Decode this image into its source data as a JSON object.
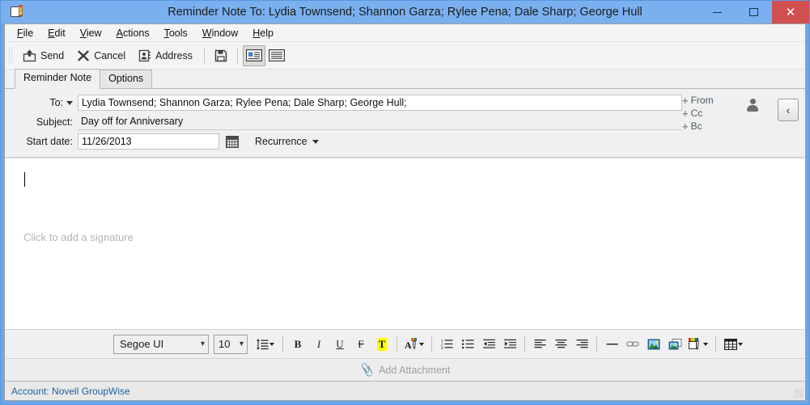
{
  "window": {
    "title": "Reminder Note To: Lydia Townsend; Shannon Garza; Rylee Pena; Dale Sharp; George Hull",
    "app_icon": "note-pencil-icon",
    "titlebar_color": "#7ab0ef",
    "frame_color": "#6ba6e8",
    "close_color": "#d05050",
    "minimize_label": "Minimize",
    "maximize_label": "Maximize",
    "close_label": "Close"
  },
  "menubar": {
    "items": [
      {
        "name": "file",
        "pre": "F",
        "rest": "ile"
      },
      {
        "name": "edit",
        "pre": "E",
        "rest": "dit"
      },
      {
        "name": "view",
        "pre": "V",
        "rest": "iew"
      },
      {
        "name": "actions",
        "pre": "A",
        "rest": "ctions"
      },
      {
        "name": "tools",
        "pre": "T",
        "rest": "ools"
      },
      {
        "name": "window",
        "pre": "W",
        "rest": "indow"
      },
      {
        "name": "help",
        "pre": "H",
        "rest": "elp"
      }
    ]
  },
  "toolbar": {
    "send_label": "Send",
    "cancel_label": "Cancel",
    "address_label": "Address",
    "save_label": "Save",
    "view_split_label": "Split View",
    "view_plain_label": "Plain View"
  },
  "tabs": [
    {
      "label": "Reminder Note",
      "active": true
    },
    {
      "label": "Options",
      "active": false
    }
  ],
  "header": {
    "to_label": "To:",
    "to_value": "Lydia Townsend;  Shannon Garza;  Rylee Pena;  Dale Sharp;  George Hull;",
    "subject_label": "Subject:",
    "subject_value": "Day off for Anniversary",
    "startdate_label": "Start date:",
    "startdate_value": "11/26/2013",
    "recurrence_label": "Recurrence",
    "calendar_icon": "calendar-icon",
    "address_links": [
      {
        "name": "from",
        "plus": "+",
        "label": "From"
      },
      {
        "name": "cc",
        "plus": "+",
        "label": "Cc"
      },
      {
        "name": "bc",
        "plus": "+",
        "label": "Bc"
      }
    ],
    "person_icon": "person-icon",
    "collapse_label": "‹",
    "link_color": "#4a5a63",
    "plus_color": "#7d9a7d"
  },
  "body": {
    "content": "",
    "signature_placeholder": "Click to add a signature"
  },
  "formatbar": {
    "font_name": "Segoe UI",
    "font_size": "10",
    "line_spacing_label": "Line Spacing",
    "bold_label": "B",
    "italic_label": "I",
    "underline_label": "U",
    "strikethrough_label": "F",
    "highlight_label": "T",
    "font_color_label": "A",
    "numbered_list_label": "Numbered List",
    "bulleted_list_label": "Bulleted List",
    "decrease_indent_label": "Decrease Indent",
    "increase_indent_label": "Increase Indent",
    "align_left_label": "Align Left",
    "align_center_label": "Align Center",
    "align_right_label": "Align Right",
    "horizontal_line_label": "Horizontal Line",
    "hyperlink_label": "Hyperlink",
    "image_label": "Insert Image",
    "image_file_label": "Insert Image From File",
    "background_label": "Background Color",
    "table_label": "Table",
    "highlight_bg_color": "#ffff00"
  },
  "attachment": {
    "label": "Add Attachment",
    "icon": "paperclip-icon"
  },
  "statusbar": {
    "text": "Account: Novell GroupWise",
    "text_color": "#1f5fa0"
  }
}
